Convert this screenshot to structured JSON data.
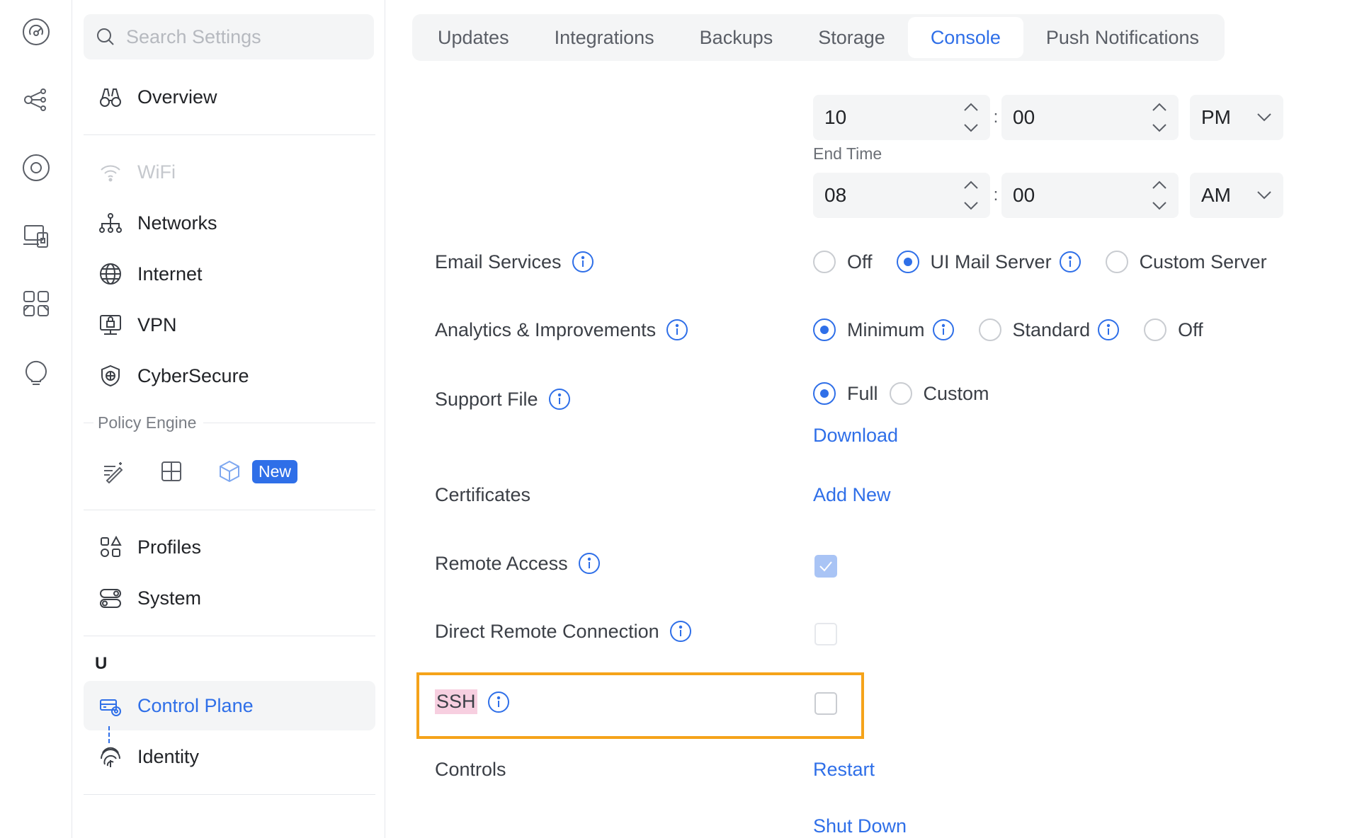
{
  "rail": {
    "icons": [
      "dashboard-icon",
      "topology-icon",
      "devices-icon",
      "client-devices-icon",
      "apps-icon",
      "insights-icon"
    ]
  },
  "sidebar": {
    "search": {
      "placeholder": "Search Settings"
    },
    "overview": "Overview",
    "wifi": "WiFi",
    "networks": "Networks",
    "internet": "Internet",
    "vpn": "VPN",
    "cybersecure": "CyberSecure",
    "policy_engine": {
      "label": "Policy Engine",
      "new_badge": "New"
    },
    "profiles": "Profiles",
    "system": "System",
    "section_u": "U",
    "control_plane": "Control Plane",
    "identity": "Identity"
  },
  "tabs": [
    {
      "label": "Updates",
      "active": false
    },
    {
      "label": "Integrations",
      "active": false
    },
    {
      "label": "Backups",
      "active": false
    },
    {
      "label": "Storage",
      "active": false
    },
    {
      "label": "Console",
      "active": true
    },
    {
      "label": "Push Notifications",
      "active": false
    }
  ],
  "schedule": {
    "start": {
      "hour": "10",
      "minute": "00",
      "period": "PM"
    },
    "end_label": "End Time",
    "end": {
      "hour": "08",
      "minute": "00",
      "period": "AM"
    },
    "separator": ":"
  },
  "email_services": {
    "label": "Email Services",
    "options": [
      "Off",
      "UI Mail Server",
      "Custom Server"
    ],
    "selected": "UI Mail Server"
  },
  "analytics": {
    "label": "Analytics & Improvements",
    "options": [
      "Minimum",
      "Standard",
      "Off"
    ],
    "selected": "Minimum"
  },
  "support_file": {
    "label": "Support File",
    "options": [
      "Full",
      "Custom"
    ],
    "selected": "Full",
    "download": "Download"
  },
  "certificates": {
    "label": "Certificates",
    "action": "Add New"
  },
  "remote_access": {
    "label": "Remote Access",
    "checked": true
  },
  "direct_remote": {
    "label": "Direct Remote Connection",
    "checked": false
  },
  "ssh": {
    "label": "SSH",
    "checked": false
  },
  "controls": {
    "label": "Controls",
    "restart": "Restart",
    "shutdown": "Shut Down"
  },
  "colors": {
    "accent": "#2f6fe8",
    "highlight": "#f5a31a",
    "ssh_mark": "#f7cfe0"
  }
}
